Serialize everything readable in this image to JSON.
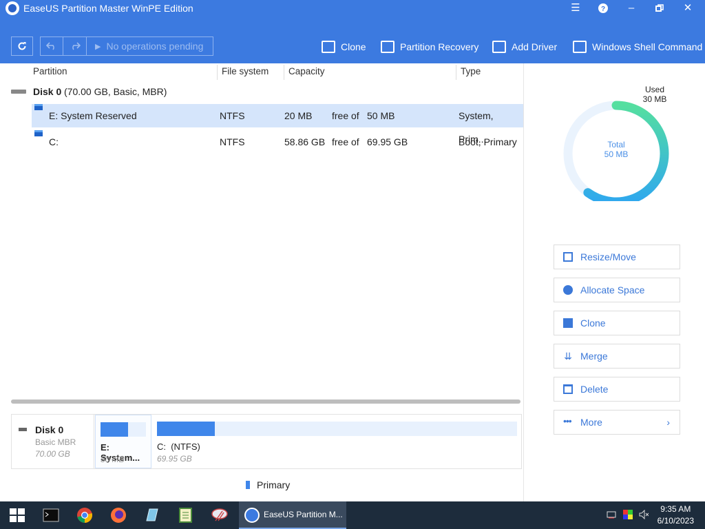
{
  "window": {
    "title": "EaseUS Partition Master WinPE Edition"
  },
  "toolbar": {
    "pending_label": "No operations pending",
    "actions": [
      {
        "label": "Clone",
        "icon": "clone-icon"
      },
      {
        "label": "Partition Recovery",
        "icon": "partition-recovery-icon"
      },
      {
        "label": "Add Driver",
        "icon": "add-driver-icon"
      },
      {
        "label": "Windows Shell Command",
        "icon": "terminal-icon"
      }
    ]
  },
  "table": {
    "headers": [
      "Partition",
      "File system",
      "Capacity",
      "Type"
    ],
    "disk": {
      "name": "Disk 0",
      "detail": "(70.00 GB, Basic, MBR)"
    },
    "rows": [
      {
        "name": "E: System Reserved",
        "fs": "NTFS",
        "free": "20 MB",
        "free_of": "free of",
        "total": "50 MB",
        "type": "System, Prim..."
      },
      {
        "name": "C:",
        "fs": "NTFS",
        "free": "58.86 GB",
        "free_of": "free of",
        "total": "69.95 GB",
        "type": "Boot, Primary"
      }
    ]
  },
  "diskmap": {
    "disk_name": "Disk 0",
    "disk_type": "Basic MBR",
    "disk_size": "70.00 GB",
    "partitions": [
      {
        "label": "E: System...",
        "size": "50 MB",
        "used_fraction": 0.6
      },
      {
        "label": "C:  (NTFS)",
        "size": "69.95 GB",
        "used_fraction": 0.16
      }
    ],
    "legend": "Primary",
    "primary_color": "#3f86ea"
  },
  "usage": {
    "used_label": "Used",
    "used_value": "30 MB",
    "total_label": "Total",
    "total_value": "50 MB",
    "used_fraction": 0.6
  },
  "operations": [
    {
      "label": "Resize/Move",
      "icon": "resize-move-icon"
    },
    {
      "label": "Allocate Space",
      "icon": "allocate-space-icon"
    },
    {
      "label": "Clone",
      "icon": "clone-icon"
    },
    {
      "label": "Merge",
      "icon": "merge-icon"
    },
    {
      "label": "Delete",
      "icon": "trash-icon"
    },
    {
      "label": "More",
      "icon": "more-icon"
    }
  ],
  "taskbar": {
    "active_app": "EaseUS Partition M...",
    "time": "9:35 AM",
    "date": "6/10/2023"
  },
  "colors": {
    "header": "#3c7ae0",
    "accent": "#3b78d8",
    "selection": "#d5e5fb"
  }
}
